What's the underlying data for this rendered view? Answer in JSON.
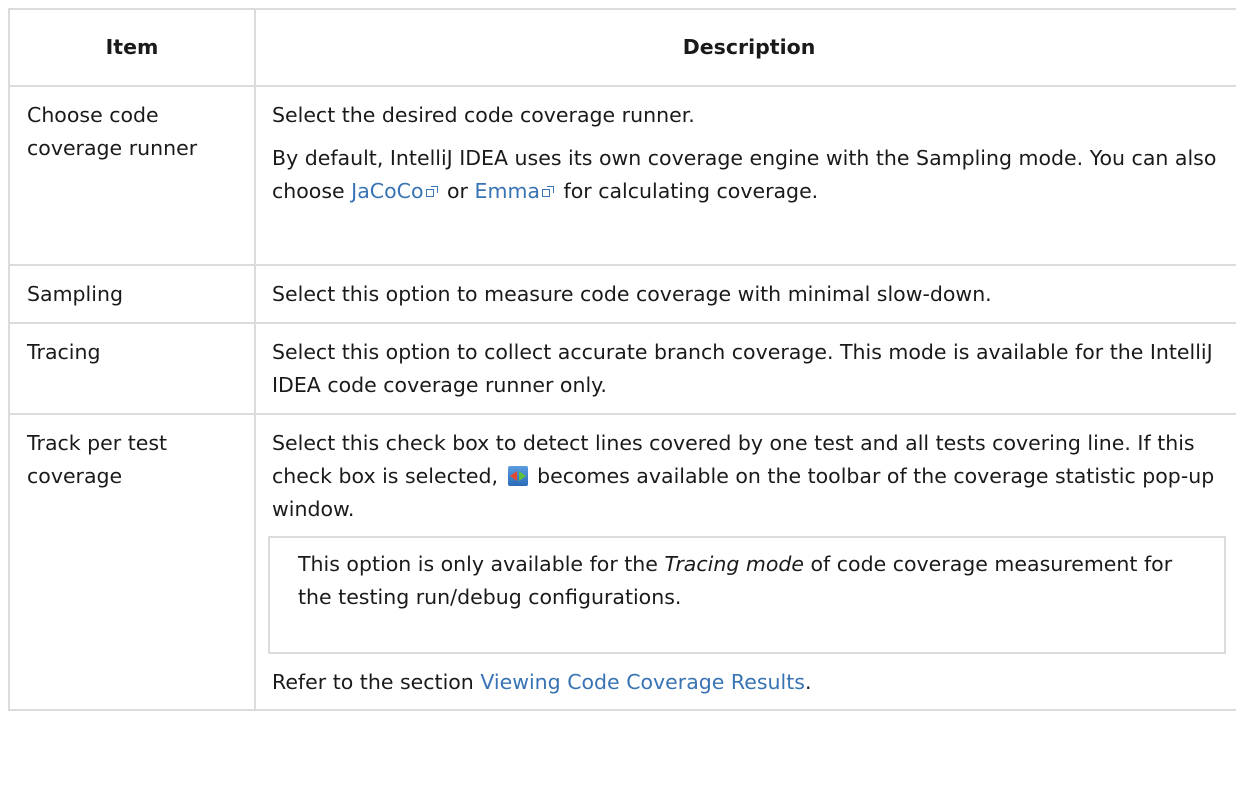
{
  "table": {
    "headers": {
      "item": "Item",
      "description": "Description"
    },
    "rows": [
      {
        "item": "Choose code coverage runner",
        "desc1": "Select the desired code coverage runner.",
        "desc2_a": "By default, IntelliJ IDEA uses its own coverage engine with the Sampling mode. You can also choose ",
        "link_jacoco": "JaCoCo",
        "desc2_b": " or ",
        "link_emma": "Emma",
        "desc2_c": " for calculating coverage."
      },
      {
        "item": "Sampling",
        "desc": "Select this option to measure code coverage with minimal slow-down."
      },
      {
        "item": "Tracing",
        "desc": "Select this option to collect accurate branch coverage. This mode is available for the IntelliJ IDEA code coverage runner only."
      },
      {
        "item": "Track per test coverage",
        "desc_a": "Select this check box to detect lines covered by one test and all tests covering line. If this check box is selected, ",
        "desc_b": " becomes available on the toolbar of the coverage statistic pop-up window.",
        "note_a": "This option is only available for the ",
        "note_em": "Tracing mode",
        "note_b": " of code coverage measurement for the testing run/debug configurations.",
        "refer_a": "Refer to the section ",
        "refer_link": "Viewing Code Coverage Results",
        "refer_b": "."
      }
    ]
  },
  "icons": {
    "external_link": "external-link-icon",
    "toolbar": "show-tests-covering-line-icon"
  },
  "colors": {
    "link": "#3873b4",
    "border": "#dcdcdc"
  }
}
